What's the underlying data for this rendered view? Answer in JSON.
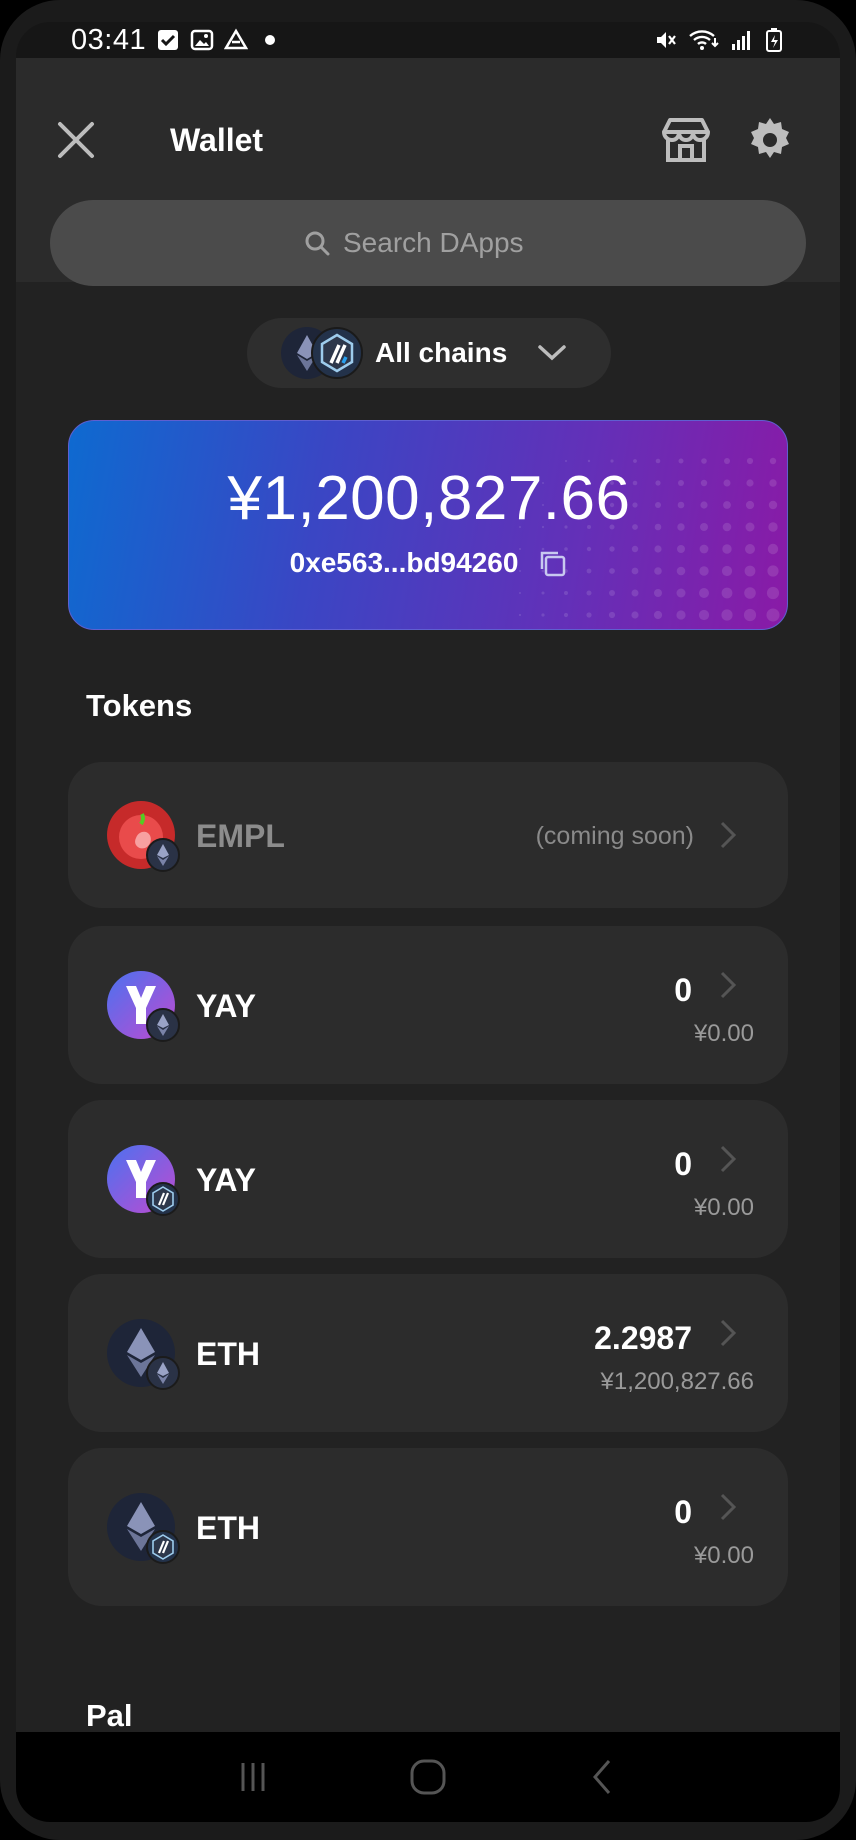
{
  "status_bar": {
    "time": "03:41"
  },
  "header": {
    "title": "Wallet",
    "search_placeholder": "Search DApps"
  },
  "chain_selector": {
    "label": "All chains"
  },
  "balance": {
    "amount": "¥1,200,827.66",
    "address": "0xe563...bd94260"
  },
  "sections": {
    "tokens": "Tokens",
    "pal": "Pal"
  },
  "tokens": [
    {
      "symbol": "EMPL",
      "note": "(coming soon)",
      "chain": "ethereum"
    },
    {
      "symbol": "YAY",
      "amount": "0",
      "fiat": "¥0.00",
      "chain": "ethereum"
    },
    {
      "symbol": "YAY",
      "amount": "0",
      "fiat": "¥0.00",
      "chain": "arbitrum"
    },
    {
      "symbol": "ETH",
      "amount": "2.2987",
      "fiat": "¥1,200,827.66",
      "chain": "ethereum"
    },
    {
      "symbol": "ETH",
      "amount": "0",
      "fiat": "¥0.00",
      "chain": "arbitrum"
    }
  ],
  "colors": {
    "background": "#222222",
    "header": "#2b2b2b",
    "card_start": "#0e6ad0",
    "card_end": "#8a1aa6",
    "row": "#2c2c2c"
  }
}
